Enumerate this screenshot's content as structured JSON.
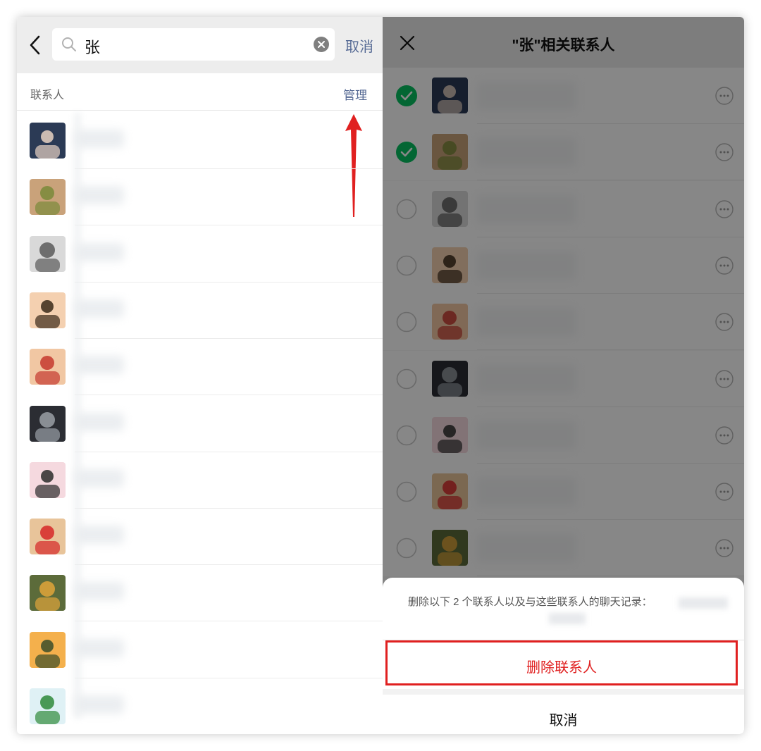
{
  "left": {
    "search": {
      "query": "张",
      "cancel_label": "取消"
    },
    "section_label": "联系人",
    "manage_label": "管理",
    "avatars": [
      {
        "icon": "avatar-portrait-woman",
        "colors": [
          "#2b3a55",
          "#e8d2c3"
        ]
      },
      {
        "icon": "avatar-cat",
        "colors": [
          "#c9a27a",
          "#7a8a3a"
        ]
      },
      {
        "icon": "avatar-grayscale-photo",
        "colors": [
          "#d9d9d9",
          "#5a5a5a"
        ]
      },
      {
        "icon": "avatar-cartoon-girl-food",
        "colors": [
          "#f4d0b0",
          "#3a2a1a"
        ]
      },
      {
        "icon": "avatar-crayon-shinchan",
        "colors": [
          "#f1c7a3",
          "#c53a2f"
        ]
      },
      {
        "icon": "avatar-dark-app",
        "colors": [
          "#2b2d33",
          "#9aa0a6"
        ]
      },
      {
        "icon": "avatar-cartoon-girl-flower",
        "colors": [
          "#f5d9df",
          "#2c2c2c"
        ]
      },
      {
        "icon": "avatar-heart-zhang",
        "colors": [
          "#e8c49a",
          "#d62828"
        ]
      },
      {
        "icon": "avatar-autumn-trees",
        "colors": [
          "#5c6b3a",
          "#e0a43a"
        ]
      },
      {
        "icon": "avatar-sunset-field",
        "colors": [
          "#f4b04c",
          "#3b4e2a"
        ]
      },
      {
        "icon": "avatar-illustration-map",
        "colors": [
          "#dff1f5",
          "#2f8a3a"
        ]
      }
    ]
  },
  "right": {
    "title": "\"张\"相关联系人",
    "rows": [
      {
        "checked": true
      },
      {
        "checked": true
      },
      {
        "checked": false
      },
      {
        "checked": false
      },
      {
        "checked": false
      },
      {
        "checked": false
      },
      {
        "checked": false
      },
      {
        "checked": false
      },
      {
        "checked": false
      }
    ],
    "sheet": {
      "message": "删除以下 2 个联系人以及与这些联系人的聊天记录：",
      "delete_label": "删除联系人",
      "cancel_label": "取消"
    }
  },
  "colors": {
    "accent_link": "#576b95",
    "check_green": "#07c160",
    "danger_red": "#e02020"
  }
}
